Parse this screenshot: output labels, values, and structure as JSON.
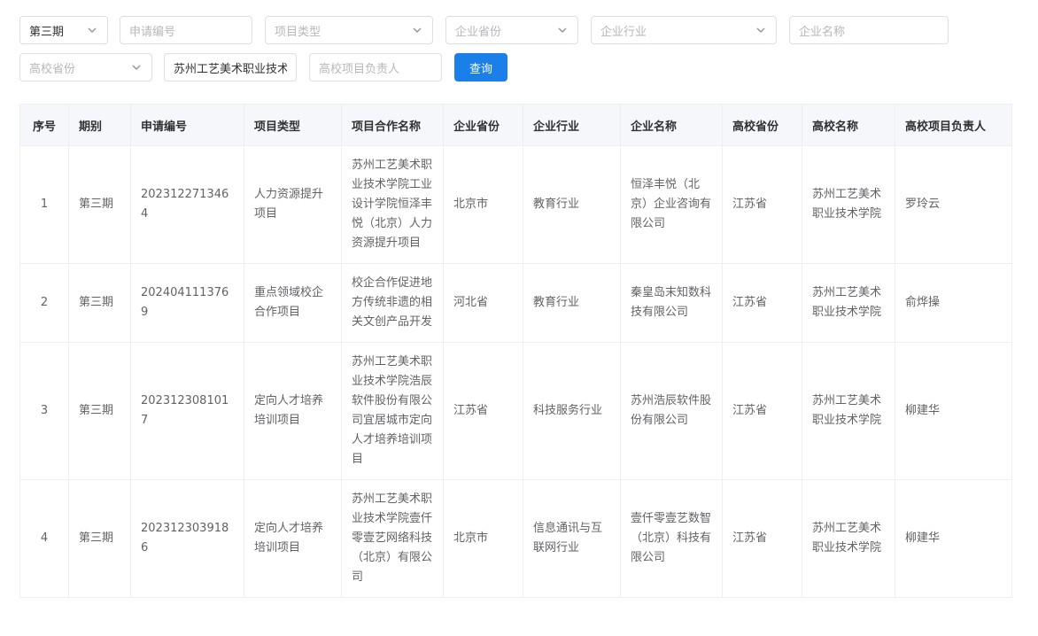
{
  "filters": {
    "period": "第三期",
    "app_no_placeholder": "申请编号",
    "project_type_placeholder": "项目类型",
    "company_province_placeholder": "企业省份",
    "company_industry_placeholder": "企业行业",
    "company_name_placeholder": "企业名称",
    "school_province_placeholder": "高校省份",
    "school_name_value": "苏州工艺美术职业技术学院",
    "leader_placeholder": "高校项目负责人",
    "query_label": "查询"
  },
  "table": {
    "headers": [
      "序号",
      "期别",
      "申请编号",
      "项目类型",
      "项目合作名称",
      "企业省份",
      "企业行业",
      "企业名称",
      "高校省份",
      "高校名称",
      "高校项目负责人"
    ],
    "rows": [
      [
        "1",
        "第三期",
        "2023122713464",
        "人力资源提升项目",
        "苏州工艺美术职业技术学院工业设计学院恒泽丰悦（北京）人力资源提升项目",
        "北京市",
        "教育行业",
        "恒泽丰悦（北京）企业咨询有限公司",
        "江苏省",
        "苏州工艺美术职业技术学院",
        "罗玲云"
      ],
      [
        "2",
        "第三期",
        "2024041113769",
        "重点领域校企合作项目",
        "校企合作促进地方传统非遗的相关文创产品开发",
        "河北省",
        "教育行业",
        "秦皇岛末知数科技有限公司",
        "江苏省",
        "苏州工艺美术职业技术学院",
        "俞烨操"
      ],
      [
        "3",
        "第三期",
        "2023123081017",
        "定向人才培养培训项目",
        "苏州工艺美术职业技术学院浩辰软件股份有限公司宜居城市定向人才培养培训项目",
        "江苏省",
        "科技服务行业",
        "苏州浩辰软件股份有限公司",
        "江苏省",
        "苏州工艺美术职业技术学院",
        "柳建华"
      ],
      [
        "4",
        "第三期",
        "2023123039186",
        "定向人才培养培训项目",
        "苏州工艺美术职业技术学院壹仟零壹艺网络科技（北京）有限公司",
        "北京市",
        "信息通讯与互联网行业",
        "壹仟零壹艺数智（北京）科技有限公司",
        "江苏省",
        "苏州工艺美术职业技术学院",
        "柳建华"
      ]
    ]
  }
}
